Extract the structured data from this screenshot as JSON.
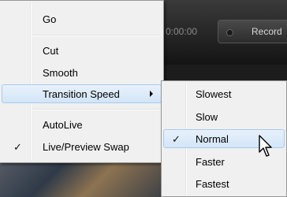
{
  "app": {
    "timecode": "0:00:00",
    "record_label": "Record"
  },
  "context_menu": {
    "items": [
      {
        "label": "Go"
      },
      {
        "label": "Cut"
      },
      {
        "label": "Smooth"
      },
      {
        "label": "Transition Speed",
        "has_submenu": true,
        "highlighted": true
      },
      {
        "label": "AutoLive"
      },
      {
        "label": "Live/Preview Swap",
        "checked": true
      }
    ]
  },
  "submenu": {
    "items": [
      {
        "label": "Slowest"
      },
      {
        "label": "Slow"
      },
      {
        "label": "Normal",
        "checked": true,
        "highlighted": true
      },
      {
        "label": "Faster"
      },
      {
        "label": "Fastest"
      }
    ]
  },
  "icons": {
    "check": "✓",
    "cursor": "arrow-pointer-icon"
  },
  "colors": {
    "menu_bg": "#f0f0f0",
    "highlight": "#d3e5f8",
    "highlight_border": "#a8cbee"
  }
}
